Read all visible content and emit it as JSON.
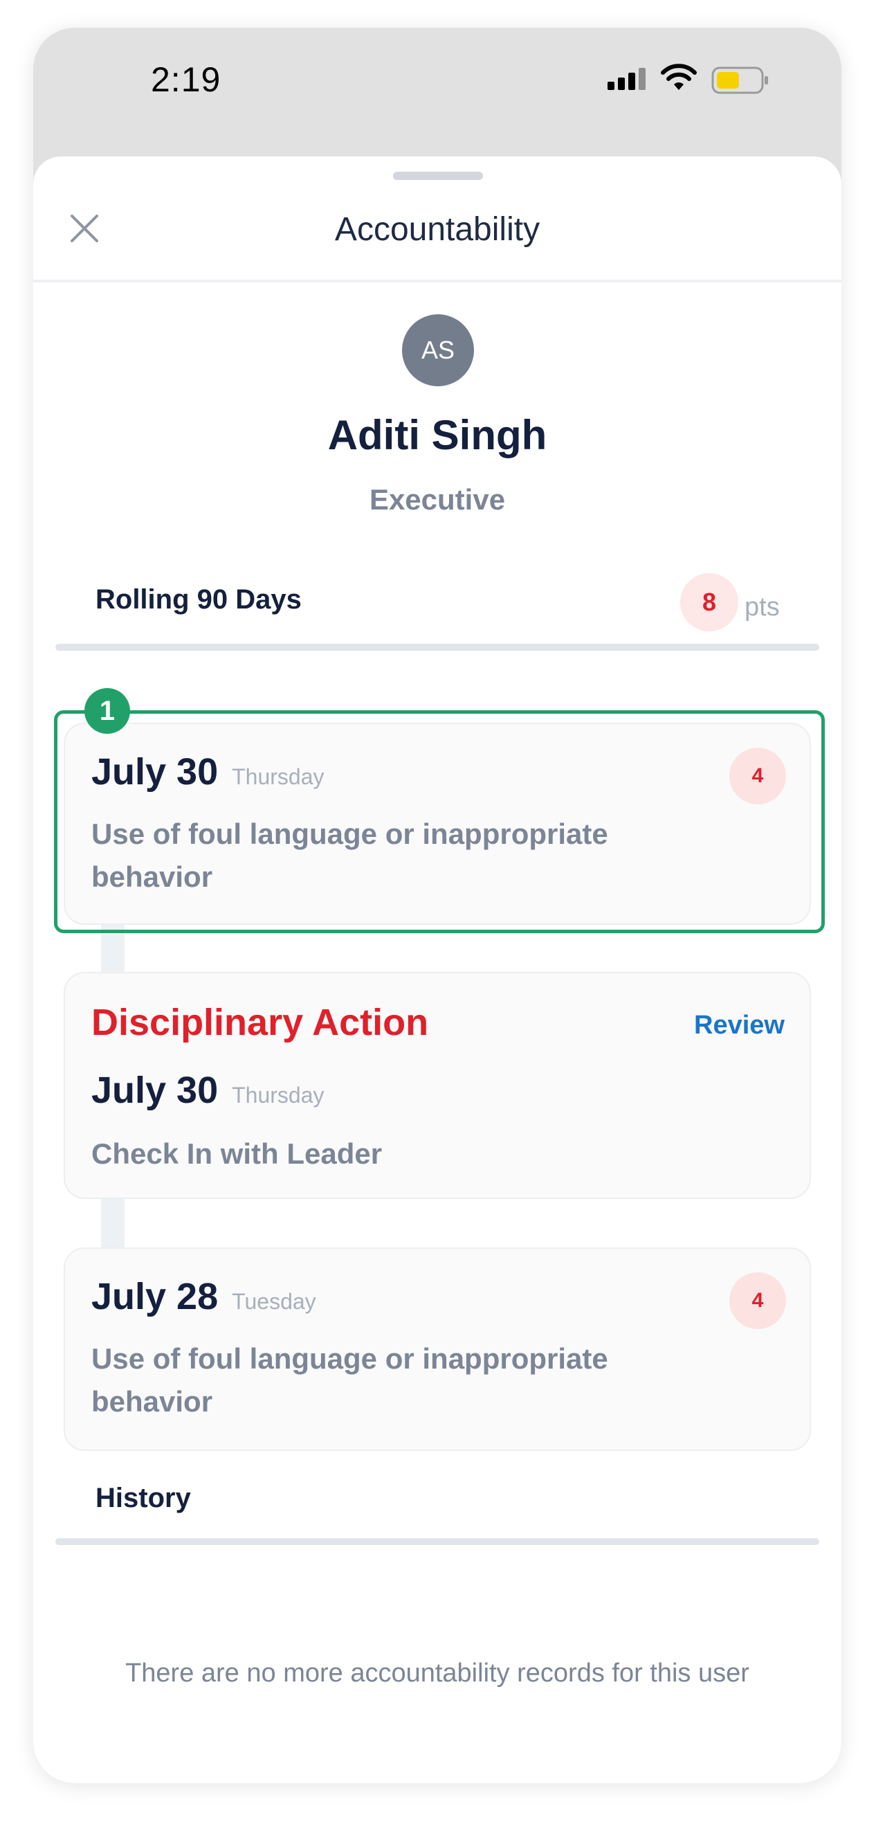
{
  "status_bar": {
    "time": "2:19",
    "battery_color": "#f6d100"
  },
  "header": {
    "title": "Accountability",
    "close_icon": "close-icon"
  },
  "user": {
    "initials": "AS",
    "name": "Aditi Singh",
    "role": "Executive"
  },
  "rolling": {
    "label": "Rolling 90 Days",
    "points": "8",
    "points_unit": "pts"
  },
  "highlight": {
    "marker": "1",
    "color": "#21a06a"
  },
  "records": [
    {
      "date": "July 30",
      "day": "Thursday",
      "description": "Use of foul language or inappropriate behavior",
      "points": "4"
    },
    {
      "type_label": "Disciplinary Action",
      "action_label": "Review",
      "date": "July 30",
      "day": "Thursday",
      "description": "Check In with Leader"
    },
    {
      "date": "July 28",
      "day": "Tuesday",
      "description": "Use of foul language or inappropriate behavior",
      "points": "4"
    }
  ],
  "history": {
    "label": "History",
    "empty_message": "There are no more accountability records for this user"
  },
  "colors": {
    "primary_text": "#14203d",
    "secondary_text": "#7c8596",
    "danger": "#e0202a",
    "link": "#1b75c8"
  }
}
